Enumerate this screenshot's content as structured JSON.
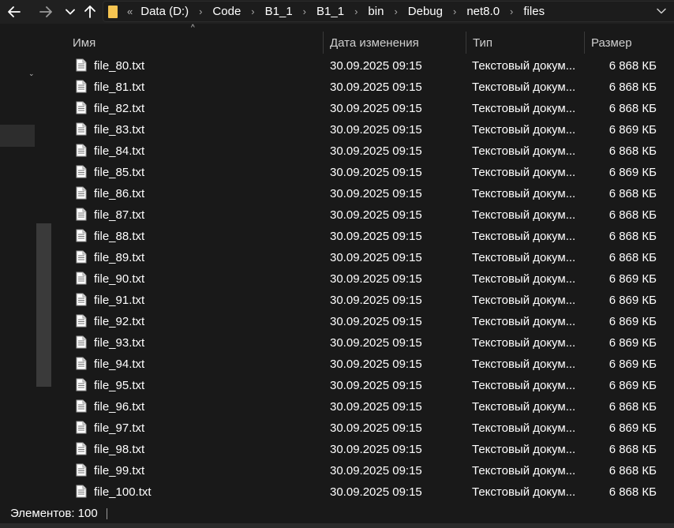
{
  "address_bar": {
    "overflow": "«",
    "breadcrumbs": [
      "Data (D:)",
      "Code",
      "B1_1",
      "B1_1",
      "bin",
      "Debug",
      "net8.0",
      "files"
    ]
  },
  "columns": {
    "name": "Имя",
    "date": "Дата изменения",
    "type": "Тип",
    "size": "Размер"
  },
  "files": [
    {
      "name": "file_80.txt",
      "date": "30.09.2025 09:15",
      "type": "Текстовый докум...",
      "size": "6 868 КБ"
    },
    {
      "name": "file_81.txt",
      "date": "30.09.2025 09:15",
      "type": "Текстовый докум...",
      "size": "6 868 КБ"
    },
    {
      "name": "file_82.txt",
      "date": "30.09.2025 09:15",
      "type": "Текстовый докум...",
      "size": "6 868 КБ"
    },
    {
      "name": "file_83.txt",
      "date": "30.09.2025 09:15",
      "type": "Текстовый докум...",
      "size": "6 869 КБ"
    },
    {
      "name": "file_84.txt",
      "date": "30.09.2025 09:15",
      "type": "Текстовый докум...",
      "size": "6 868 КБ"
    },
    {
      "name": "file_85.txt",
      "date": "30.09.2025 09:15",
      "type": "Текстовый докум...",
      "size": "6 869 КБ"
    },
    {
      "name": "file_86.txt",
      "date": "30.09.2025 09:15",
      "type": "Текстовый докум...",
      "size": "6 868 КБ"
    },
    {
      "name": "file_87.txt",
      "date": "30.09.2025 09:15",
      "type": "Текстовый докум...",
      "size": "6 868 КБ"
    },
    {
      "name": "file_88.txt",
      "date": "30.09.2025 09:15",
      "type": "Текстовый докум...",
      "size": "6 868 КБ"
    },
    {
      "name": "file_89.txt",
      "date": "30.09.2025 09:15",
      "type": "Текстовый докум...",
      "size": "6 868 КБ"
    },
    {
      "name": "file_90.txt",
      "date": "30.09.2025 09:15",
      "type": "Текстовый докум...",
      "size": "6 869 КБ"
    },
    {
      "name": "file_91.txt",
      "date": "30.09.2025 09:15",
      "type": "Текстовый докум...",
      "size": "6 869 КБ"
    },
    {
      "name": "file_92.txt",
      "date": "30.09.2025 09:15",
      "type": "Текстовый докум...",
      "size": "6 869 КБ"
    },
    {
      "name": "file_93.txt",
      "date": "30.09.2025 09:15",
      "type": "Текстовый докум...",
      "size": "6 869 КБ"
    },
    {
      "name": "file_94.txt",
      "date": "30.09.2025 09:15",
      "type": "Текстовый докум...",
      "size": "6 869 КБ"
    },
    {
      "name": "file_95.txt",
      "date": "30.09.2025 09:15",
      "type": "Текстовый докум...",
      "size": "6 869 КБ"
    },
    {
      "name": "file_96.txt",
      "date": "30.09.2025 09:15",
      "type": "Текстовый докум...",
      "size": "6 868 КБ"
    },
    {
      "name": "file_97.txt",
      "date": "30.09.2025 09:15",
      "type": "Текстовый докум...",
      "size": "6 869 КБ"
    },
    {
      "name": "file_98.txt",
      "date": "30.09.2025 09:15",
      "type": "Текстовый докум...",
      "size": "6 868 КБ"
    },
    {
      "name": "file_99.txt",
      "date": "30.09.2025 09:15",
      "type": "Текстовый докум...",
      "size": "6 868 КБ"
    },
    {
      "name": "file_100.txt",
      "date": "30.09.2025 09:15",
      "type": "Текстовый докум...",
      "size": "6 868 КБ"
    }
  ],
  "status_bar": {
    "item_count": "Элементов: 100"
  },
  "icons": {
    "back": "arrow-left-icon",
    "forward": "arrow-right-icon",
    "recent": "chevron-down-icon",
    "up": "arrow-up-icon",
    "folder": "folder-icon",
    "file": "text-document-icon",
    "address_dropdown": "chevron-down-icon"
  },
  "colors": {
    "background": "#191919",
    "toolbar": "#202020",
    "text": "#ffffff",
    "folder_accent": "#f5c451"
  }
}
